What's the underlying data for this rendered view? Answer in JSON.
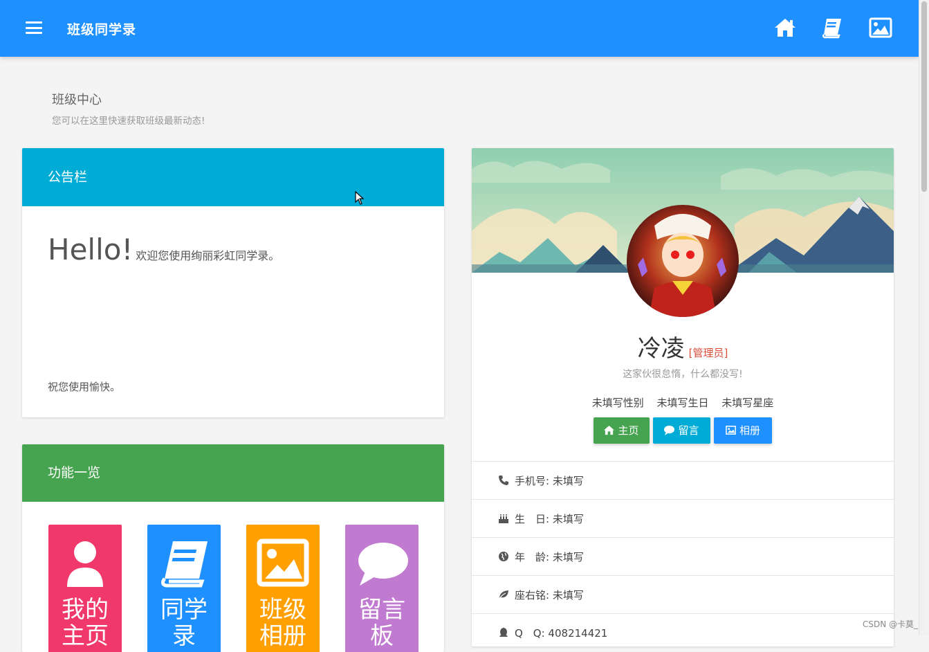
{
  "app": {
    "title": "班级同学录"
  },
  "page": {
    "title": "班级中心",
    "subtitle": "您可以在这里快速获取班级最新动态!"
  },
  "notice": {
    "header": "公告栏",
    "hello": "Hello!",
    "welcome": "欢迎您使用绚丽彩虹同学录。",
    "footer": "祝您使用愉快。"
  },
  "features": {
    "header": "功能一览",
    "tiles": [
      {
        "label": "我的主页",
        "icon": "user-icon",
        "color": "#f0386b"
      },
      {
        "label": "同学录",
        "icon": "book-icon",
        "color": "#1e90ff"
      },
      {
        "label": "班级相册",
        "icon": "image-icon",
        "color": "#ff9f00"
      },
      {
        "label": "留言板",
        "icon": "comment-icon",
        "color": "#c07ad0"
      }
    ]
  },
  "profile": {
    "name": "冷凌",
    "role": "[管理员]",
    "motto": "这家伙很怠惰，什么都没写!",
    "info": [
      "未填写性别",
      "未填写生日",
      "未填写星座"
    ],
    "buttons": [
      {
        "label": "主页",
        "icon": "home-icon",
        "color": "#46a34f"
      },
      {
        "label": "留言",
        "icon": "comment-icon",
        "color": "#00acd6"
      },
      {
        "label": "相册",
        "icon": "image-icon",
        "color": "#1e90ff"
      }
    ],
    "details": [
      {
        "icon": "phone-icon",
        "text": "手机号: 未填写"
      },
      {
        "icon": "birthday-cake-icon",
        "text": "生　日: 未填写"
      },
      {
        "icon": "globe-icon",
        "text": "年　龄: 未填写"
      },
      {
        "icon": "leaf-icon",
        "text": "座右铭: 未填写"
      },
      {
        "icon": "qq-icon",
        "text": "Q　Q: 408214421"
      }
    ]
  },
  "watermark": "CSDN @卡莫_",
  "colors": {
    "primary": "#1e90ff",
    "notice": "#00acd6",
    "features": "#46a34f",
    "role": "#dd4b39"
  }
}
